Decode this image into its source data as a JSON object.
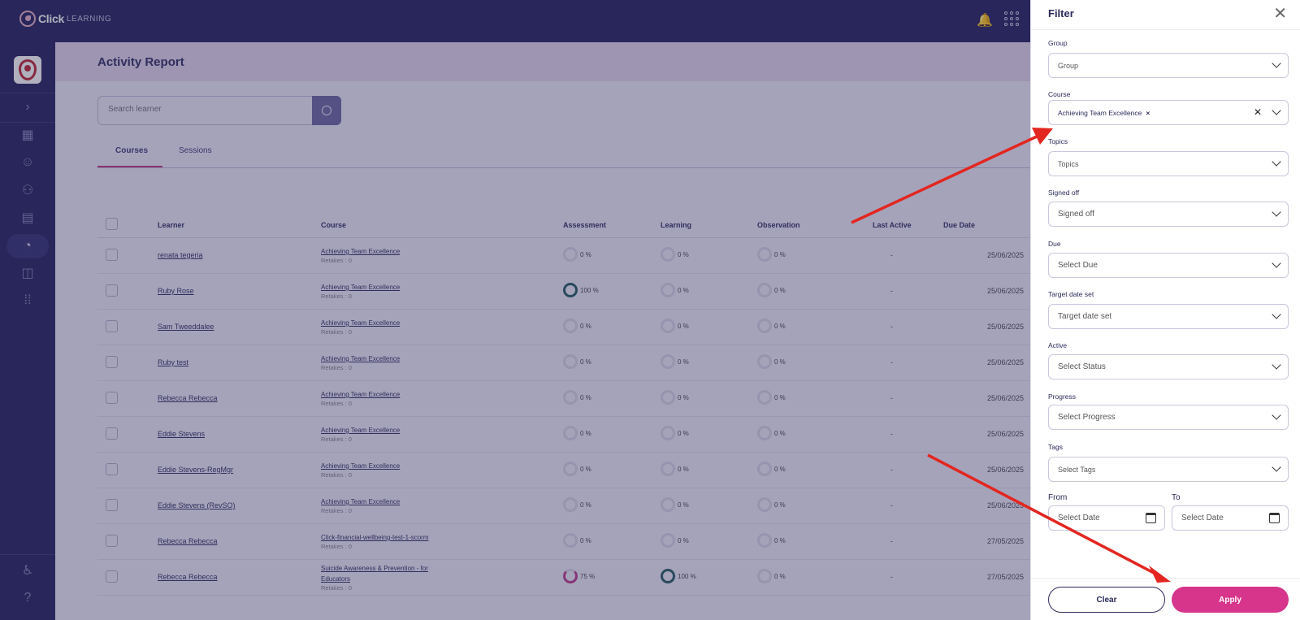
{
  "brand": {
    "name_bold": "Click",
    "name_light": "LEARNING"
  },
  "topbar": {
    "bell_icon": "bell-icon",
    "apps_icon": "apps-grid-icon"
  },
  "sidebar": {
    "icons": [
      "expand-chevron-icon",
      "dashboard-icon",
      "users-icon",
      "groups-icon",
      "clipboard-icon",
      "reports-icon",
      "shapes-icon",
      "apps-icon",
      "accessibility-icon",
      "help-icon"
    ]
  },
  "page": {
    "title": "Activity Report"
  },
  "search": {
    "placeholder": "Search learner"
  },
  "tabs": [
    "Courses",
    "Sessions"
  ],
  "table": {
    "headers": {
      "learner": "Learner",
      "course": "Course",
      "assessment": "Assessment",
      "learning": "Learning",
      "observation": "Observation",
      "last_active": "Last Active",
      "due_date": "Due Date"
    },
    "rows": [
      {
        "learner": "renata tegeria",
        "course": "Achieving Team Excellence",
        "course2": "",
        "retakes": "Retakes : 0",
        "assessment": "0 %",
        "learning": "0 %",
        "observation": "0 %",
        "last_active": "-",
        "due": "25/06/2025"
      },
      {
        "learner": "Ruby Rose",
        "course": "Achieving Team Excellence",
        "course2": "",
        "retakes": "Retakes : 0",
        "assessment": "100 %",
        "learning": "0 %",
        "observation": "0 %",
        "last_active": "-",
        "due": "25/06/2025"
      },
      {
        "learner": "Sam Tweeddalee",
        "course": "Achieving Team Excellence",
        "course2": "",
        "retakes": "Retakes : 0",
        "assessment": "0 %",
        "learning": "0 %",
        "observation": "0 %",
        "last_active": "-",
        "due": "25/06/2025"
      },
      {
        "learner": "Ruby test",
        "course": "Achieving Team Excellence",
        "course2": "",
        "retakes": "Retakes : 0",
        "assessment": "0 %",
        "learning": "0 %",
        "observation": "0 %",
        "last_active": "-",
        "due": "25/06/2025"
      },
      {
        "learner": "Rebecca Rebecca",
        "course": "Achieving Team Excellence",
        "course2": "",
        "retakes": "Retakes : 0",
        "assessment": "0 %",
        "learning": "0 %",
        "observation": "0 %",
        "last_active": "-",
        "due": "25/06/2025"
      },
      {
        "learner": "Eddie Stevens",
        "course": "Achieving Team Excellence",
        "course2": "",
        "retakes": "Retakes : 0",
        "assessment": "0 %",
        "learning": "0 %",
        "observation": "0 %",
        "last_active": "-",
        "due": "25/06/2025"
      },
      {
        "learner": "Eddie Stevens-RegMgr",
        "course": "Achieving Team Excellence",
        "course2": "",
        "retakes": "Retakes : 0",
        "assessment": "0 %",
        "learning": "0 %",
        "observation": "0 %",
        "last_active": "-",
        "due": "25/06/2025"
      },
      {
        "learner": "Eddie Stevens (RevSO)",
        "course": "Achieving Team Excellence",
        "course2": "",
        "retakes": "Retakes : 0",
        "assessment": "0 %",
        "learning": "0 %",
        "observation": "0 %",
        "last_active": "-",
        "due": "25/06/2025"
      },
      {
        "learner": "Rebecca Rebecca",
        "course": "Click-financial-wellbeing-test-1-scorm",
        "course2": "",
        "retakes": "Retakes : 0",
        "assessment": "0 %",
        "learning": "0 %",
        "observation": "0 %",
        "last_active": "-",
        "due": "27/05/2025"
      },
      {
        "learner": "Rebecca Rebecca",
        "course": "Suicide Awareness & Prevention - for",
        "course2": "Educators",
        "retakes": "Retakes : 0",
        "assessment": "75 %",
        "learning": "100 %",
        "observation": "0 %",
        "last_active": "-",
        "due": "27/05/2025"
      }
    ]
  },
  "filter": {
    "title": "Filter",
    "group": {
      "label": "Group",
      "placeholder": "Group"
    },
    "course": {
      "label": "Course",
      "chip": "Achieving Team Excellence"
    },
    "topics": {
      "label": "Topics",
      "placeholder": "Topics"
    },
    "signed_off": {
      "label": "Signed off",
      "value": "Signed off"
    },
    "due": {
      "label": "Due",
      "placeholder": "Select Due"
    },
    "target_date_set": {
      "label": "Target date set",
      "value": "Target date set"
    },
    "active": {
      "label": "Active",
      "placeholder": "Select Status"
    },
    "progress": {
      "label": "Progress",
      "placeholder": "Select Progress"
    },
    "tags": {
      "label": "Tags",
      "placeholder": "Select Tags"
    },
    "from": {
      "label": "From",
      "placeholder": "Select Date"
    },
    "to": {
      "label": "To",
      "placeholder": "Select Date"
    },
    "clear_label": "Clear",
    "apply_label": "Apply"
  },
  "colors": {
    "navy": "#2f2c66",
    "accent": "#d6358b",
    "arrow": "#e32620",
    "ring_full": "#1e5b58"
  }
}
